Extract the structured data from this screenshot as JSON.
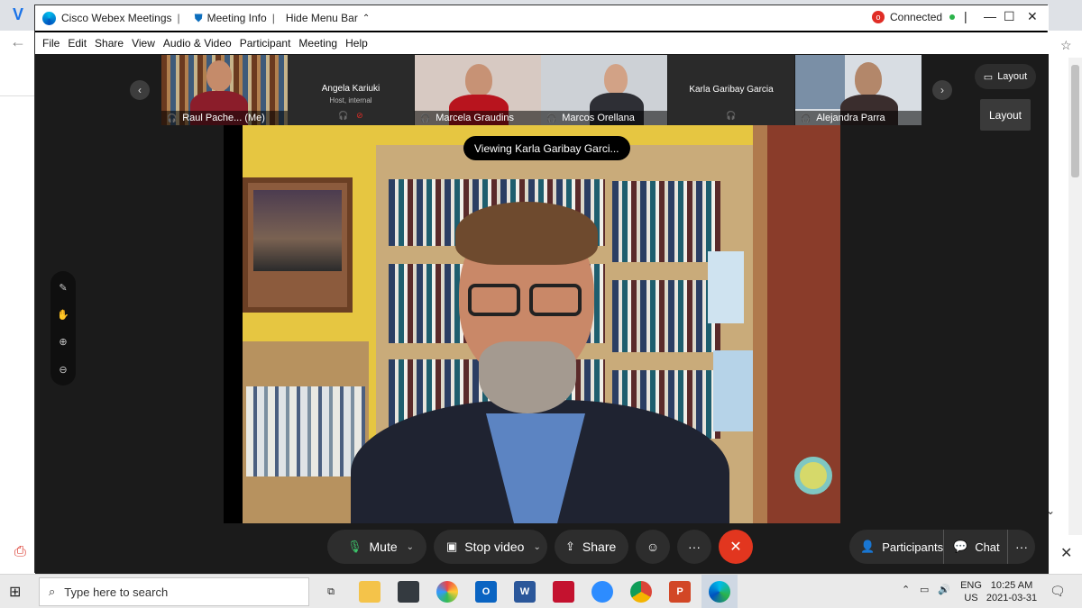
{
  "window": {
    "app_title": "Cisco Webex Meetings",
    "meeting_info": "Meeting Info",
    "hide_menu_bar": "Hide Menu Bar",
    "connection_status": "Connected",
    "rec_badge": "o"
  },
  "menu": [
    "File",
    "Edit",
    "Share",
    "View",
    "Audio & Video",
    "Participant",
    "Meeting",
    "Help"
  ],
  "participants": [
    {
      "name": "Raul Pache... (Me)"
    },
    {
      "name": "Angela Kariuki",
      "role": "Host, internal"
    },
    {
      "name": "Marcela Graudins"
    },
    {
      "name": "Marcos Orellana"
    },
    {
      "name": "Karla Garibay Garcia"
    },
    {
      "name": "Alejandra Parra"
    }
  ],
  "layout": {
    "button_label": "Layout",
    "tooltip": "Layout"
  },
  "main_video": {
    "viewing_label": "Viewing Karla Garibay Garci..."
  },
  "controls": {
    "mute_label": "Mute",
    "stop_video_label": "Stop video",
    "share_label": "Share",
    "participants_label": "Participants",
    "chat_label": "Chat",
    "more_label": "···"
  },
  "taskbar": {
    "search_placeholder": "Type here to search",
    "lang_top": "ENG",
    "lang_bottom": "US",
    "time": "10:25 AM",
    "date": "2021-03-31",
    "app_letters": {
      "outlook": "O",
      "word": "W",
      "powerpoint": "P"
    }
  },
  "colors": {
    "end_call": "#e2361f",
    "connected_dot": "#2bb34a",
    "record": "#e02d26",
    "mic_active": "#3cc66b"
  }
}
